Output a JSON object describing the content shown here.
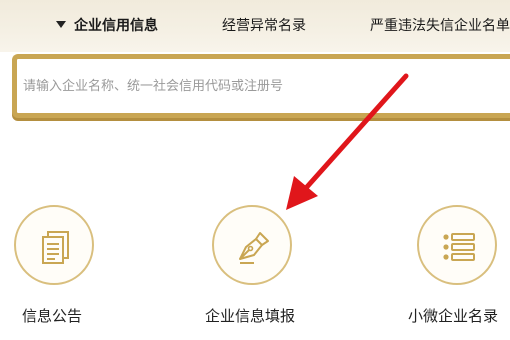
{
  "tabs": [
    {
      "label": "企业信用信息",
      "active": true
    },
    {
      "label": "经营异常名录",
      "active": false
    },
    {
      "label": "严重违法失信企业名单",
      "active": false
    }
  ],
  "search": {
    "placeholder": "请输入企业名称、统一社会信用代码或注册号",
    "value": ""
  },
  "features": [
    {
      "label": "信息公告",
      "icon": "document-icon"
    },
    {
      "label": "企业信息填报",
      "icon": "pen-icon"
    },
    {
      "label": "小微企业名录",
      "icon": "list-icon"
    }
  ],
  "colors": {
    "accent_gold": "#c9a653",
    "icon_gold": "#c9a653",
    "arrow_red": "#e0161b",
    "banner": "#f3eee2"
  }
}
